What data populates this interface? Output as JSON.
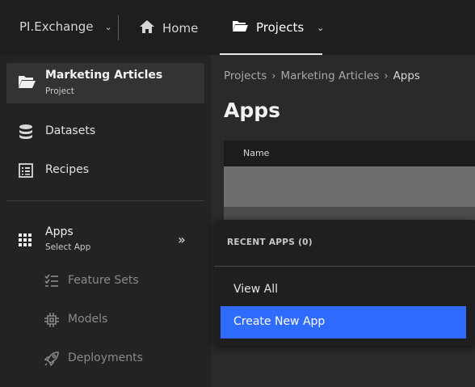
{
  "topbar": {
    "brand": "PI.Exchange",
    "home_label": "Home",
    "projects_label": "Projects"
  },
  "sidebar": {
    "project": {
      "name": "Marketing Articles",
      "subtitle": "Project"
    },
    "items": [
      {
        "label": "Datasets",
        "icon": "database-icon"
      },
      {
        "label": "Recipes",
        "icon": "list-icon"
      }
    ],
    "apps": {
      "label": "Apps",
      "subtitle": "Select App",
      "icon": "grid-icon"
    },
    "sub_items": [
      {
        "label": "Feature Sets",
        "icon": "checklist-icon"
      },
      {
        "label": "Models",
        "icon": "chip-icon"
      },
      {
        "label": "Deployments",
        "icon": "rocket-icon"
      }
    ]
  },
  "main": {
    "breadcrumb": [
      "Projects",
      "Marketing Articles",
      "Apps"
    ],
    "title": "Apps",
    "table": {
      "columns": [
        "Name"
      ]
    }
  },
  "menu": {
    "heading": "RECENT APPS (0)",
    "view_all": "View All",
    "create_new": "Create New App"
  },
  "colors": {
    "accent": "#2f6bff",
    "background": "#1e1e1e",
    "sidebar": "#232323",
    "main": "#2a2a2a"
  }
}
